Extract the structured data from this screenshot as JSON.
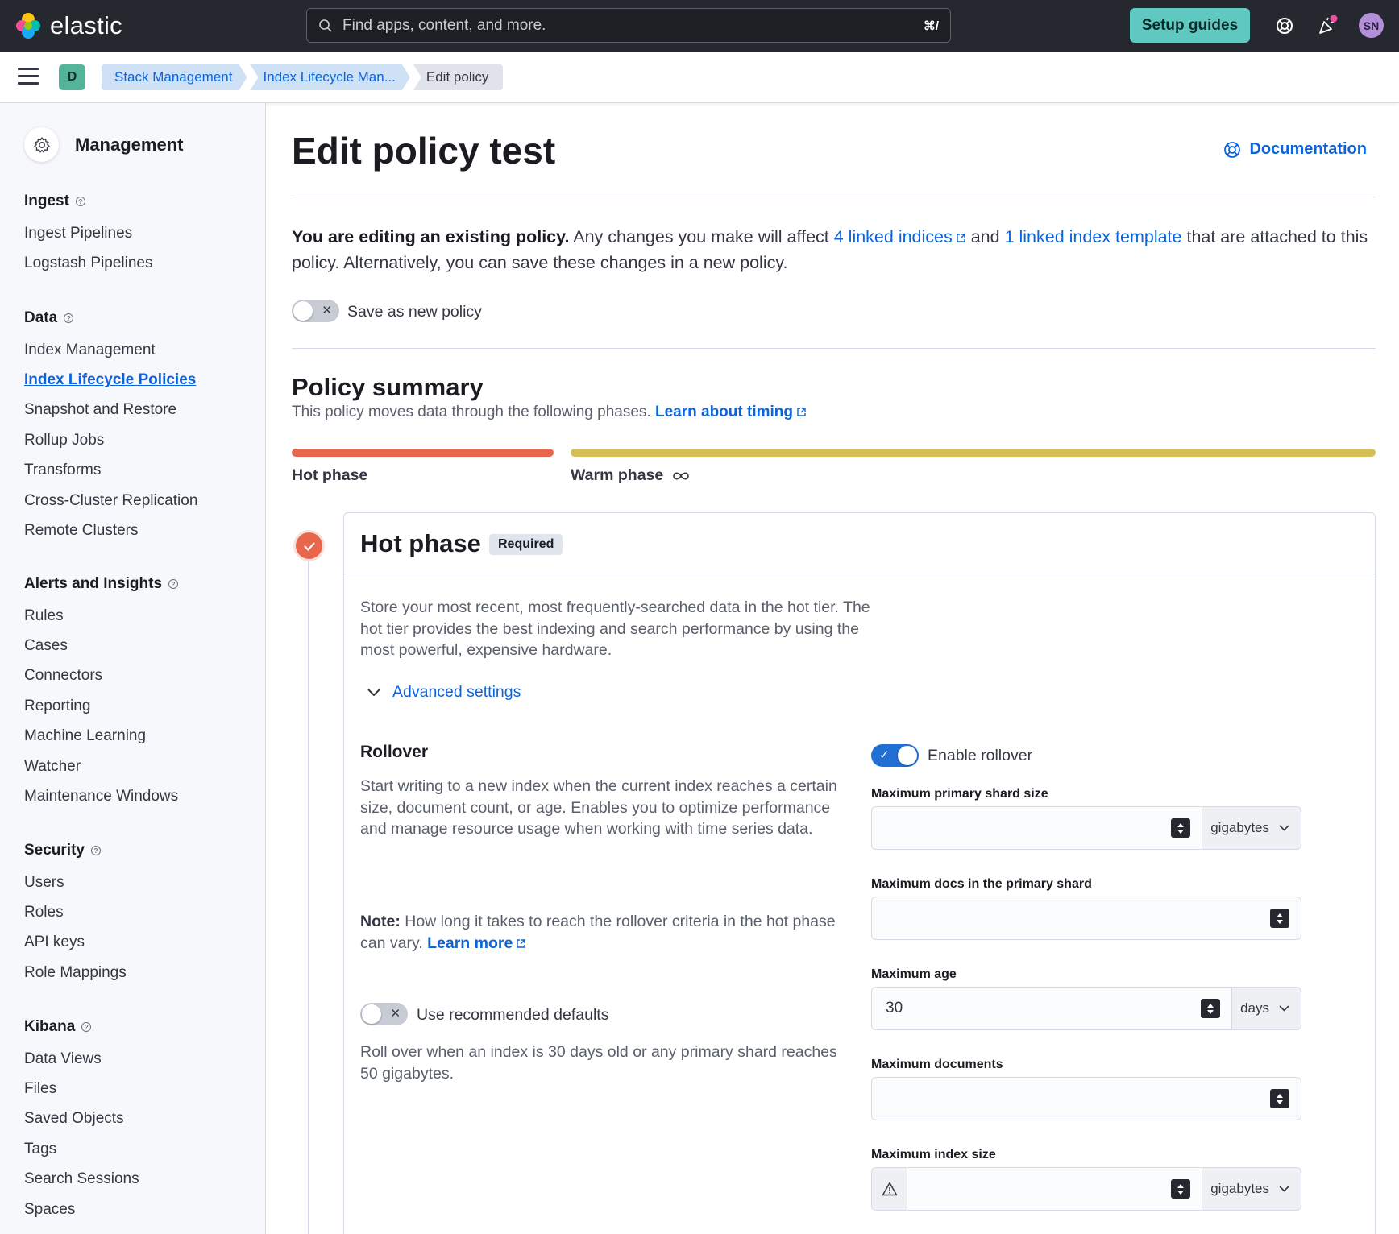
{
  "header": {
    "logo_text": "elastic",
    "search_placeholder": "Find apps, content, and more.",
    "search_shortcut": "⌘/",
    "setup_guides": "Setup guides",
    "avatar_initials": "SN"
  },
  "subbar": {
    "space_initial": "D",
    "breadcrumbs": [
      "Stack Management",
      "Index Lifecycle Man...",
      "Edit policy"
    ]
  },
  "sidebar": {
    "title": "Management",
    "sections": [
      {
        "title": "Ingest",
        "items": [
          "Ingest Pipelines",
          "Logstash Pipelines"
        ]
      },
      {
        "title": "Data",
        "items": [
          "Index Management",
          "Index Lifecycle Policies",
          "Snapshot and Restore",
          "Rollup Jobs",
          "Transforms",
          "Cross-Cluster Replication",
          "Remote Clusters"
        ]
      },
      {
        "title": "Alerts and Insights",
        "items": [
          "Rules",
          "Cases",
          "Connectors",
          "Reporting",
          "Machine Learning",
          "Watcher",
          "Maintenance Windows"
        ]
      },
      {
        "title": "Security",
        "items": [
          "Users",
          "Roles",
          "API keys",
          "Role Mappings"
        ]
      },
      {
        "title": "Kibana",
        "items": [
          "Data Views",
          "Files",
          "Saved Objects",
          "Tags",
          "Search Sessions",
          "Spaces"
        ]
      }
    ],
    "active_item": "Index Lifecycle Policies"
  },
  "page": {
    "title": "Edit policy test",
    "documentation": "Documentation",
    "intro_bold": "You are editing an existing policy.",
    "intro_1": " Any changes you make will affect ",
    "intro_link_1": "4 linked indices",
    "intro_2": " and ",
    "intro_link_2": "1 linked index template",
    "intro_3": " that are attached to this policy. Alternatively, you can save these changes in a new policy.",
    "save_as_new": "Save as new policy",
    "summary_title": "Policy summary",
    "summary_sub": "This policy moves data through the following phases.",
    "summary_link": "Learn about timing",
    "hot_label": "Hot phase",
    "warm_label": "Warm phase",
    "colors": {
      "hot": "#e7664c",
      "warm": "#d6bf57",
      "link": "#0b64dd"
    }
  },
  "hot_phase": {
    "title": "Hot phase",
    "badge": "Required",
    "description": "Store your most recent, most frequently-searched data in the hot tier. The hot tier provides the best indexing and search performance by using the most powerful, expensive hardware.",
    "advanced": "Advanced settings",
    "rollover_title": "Rollover",
    "rollover_desc": "Start writing to a new index when the current index reaches a certain size, document count, or age. Enables you to optimize performance and manage resource usage when working with time series data.",
    "note_bold": "Note:",
    "note_text": " How long it takes to reach the rollover criteria in the hot phase can vary. ",
    "note_link": "Learn more",
    "use_defaults": "Use recommended defaults",
    "defaults_desc": "Roll over when an index is 30 days old or any primary shard reaches 50 gigabytes.",
    "enable_rollover": "Enable rollover",
    "fields": {
      "max_shard_size": {
        "label": "Maximum primary shard size",
        "value": "",
        "unit": "gigabytes"
      },
      "max_docs_shard": {
        "label": "Maximum docs in the primary shard",
        "value": ""
      },
      "max_age": {
        "label": "Maximum age",
        "value": "30",
        "unit": "days"
      },
      "max_docs": {
        "label": "Maximum documents",
        "value": ""
      },
      "max_index_size": {
        "label": "Maximum index size",
        "value": "",
        "unit": "gigabytes"
      }
    }
  }
}
